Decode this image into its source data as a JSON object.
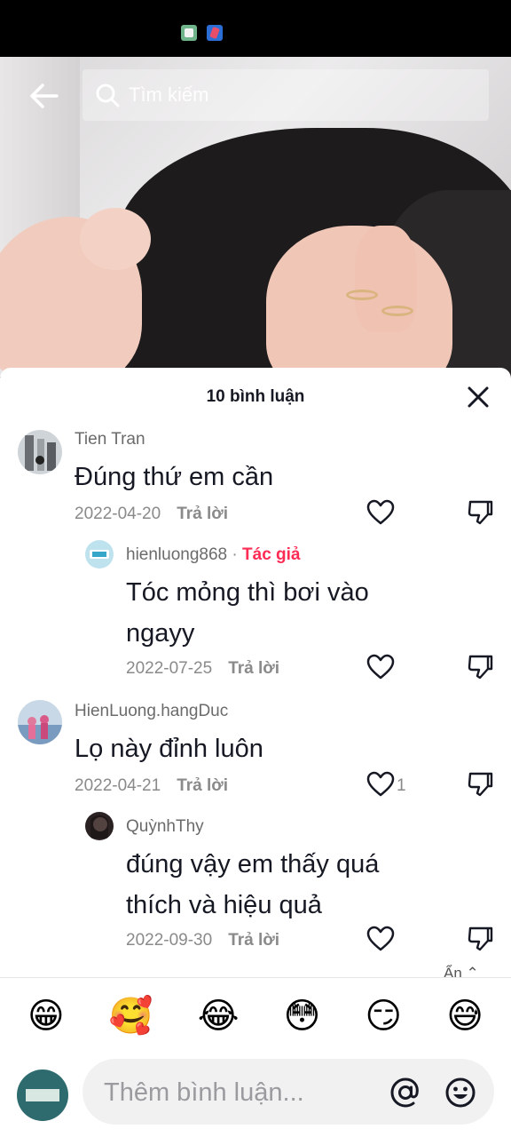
{
  "search": {
    "placeholder": "Tìm kiếm"
  },
  "sheet": {
    "count_label": "10 bình luận",
    "hide_label": "Ẩn ⌃"
  },
  "comments": [
    {
      "username": "Tien Tran",
      "text": "Đúng thứ em cần",
      "date": "2022-04-20",
      "reply_label": "Trả lời",
      "likes": ""
    },
    {
      "username": "hienluong868",
      "author_tag": "Tác giả",
      "text": "Tóc mỏng thì bơi vào ngayy",
      "date": "2022-07-25",
      "reply_label": "Trả lời",
      "likes": ""
    },
    {
      "username": "HienLuong.hangDuc",
      "text": "Lọ này đỉnh luôn",
      "date": "2022-04-21",
      "reply_label": "Trả lời",
      "likes": "1"
    },
    {
      "username": "QuỳnhThy",
      "text": "đúng vậy em thấy quá thích và hiệu quả",
      "date": "2022-09-30",
      "reply_label": "Trả lời",
      "likes": ""
    }
  ],
  "emojis": [
    "😁",
    "🥰",
    "😂",
    "😳",
    "😏",
    "😅"
  ],
  "input": {
    "placeholder": "Thêm bình luận..."
  },
  "colors": {
    "author_tag": "#fe2c55",
    "text": "#161823",
    "muted": "#8a8a8a"
  }
}
